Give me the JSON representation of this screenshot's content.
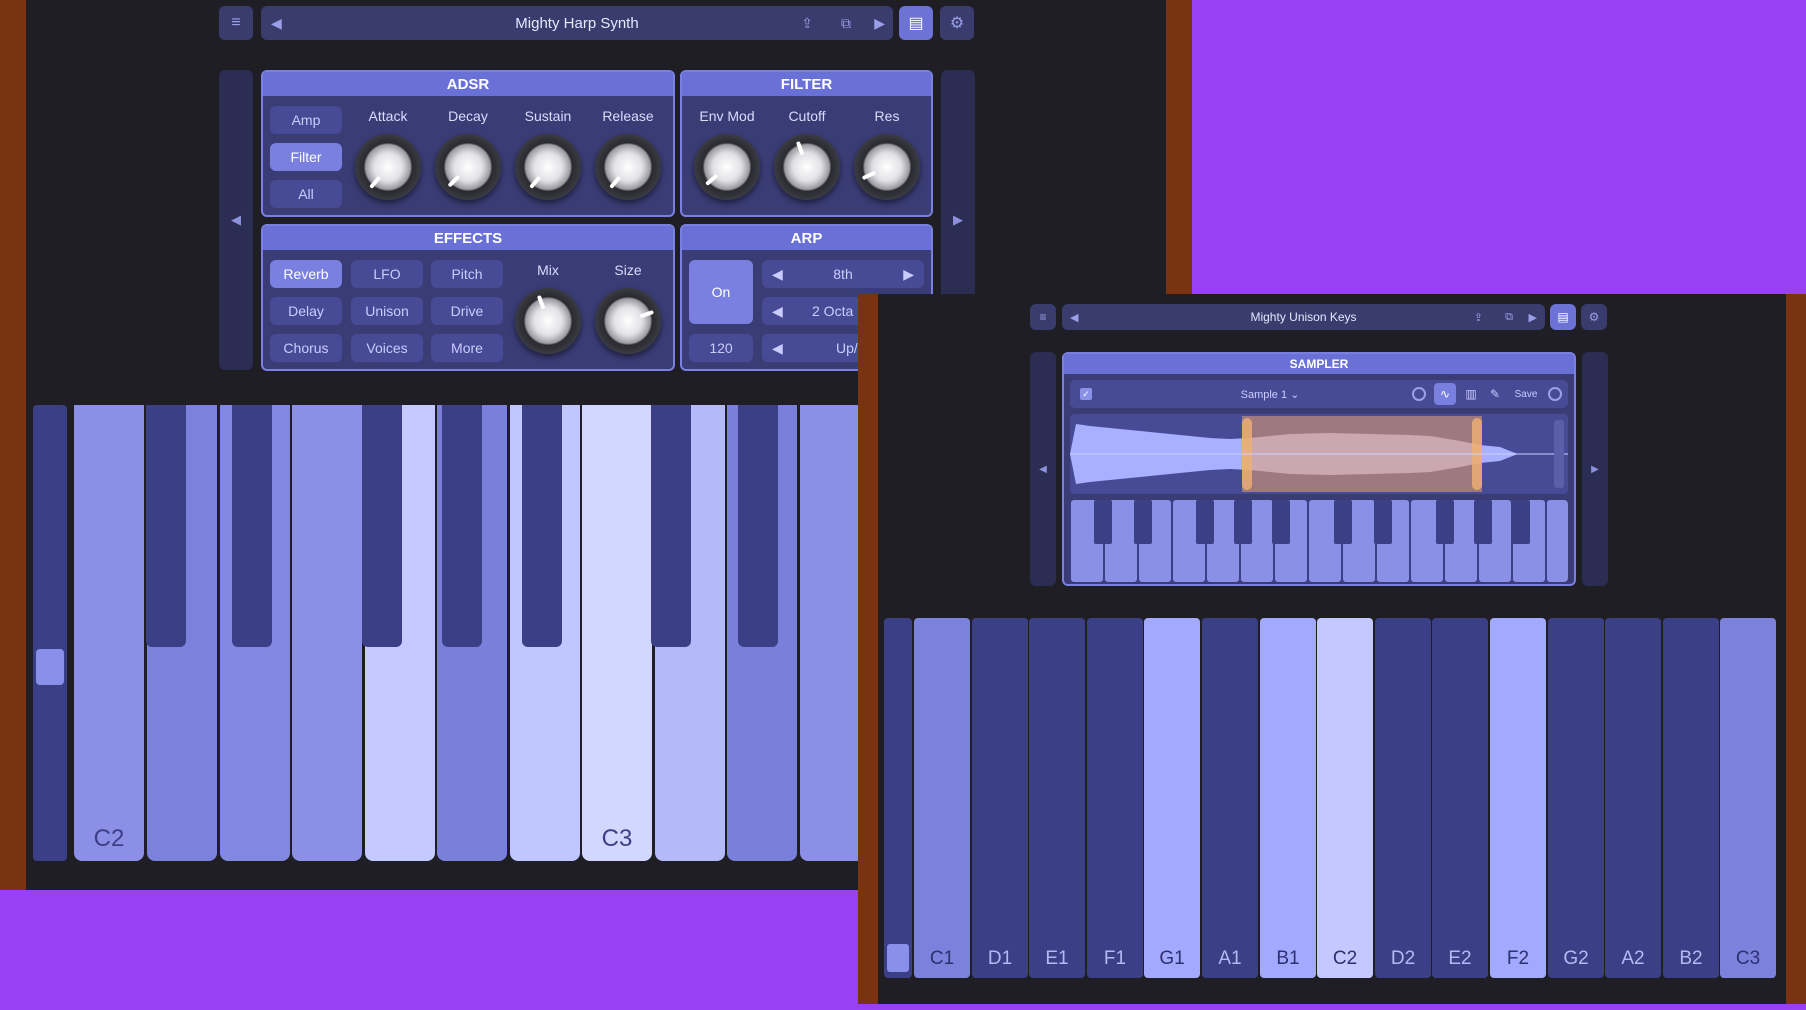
{
  "main_window": {
    "title": "Mighty Harp Synth",
    "adsr": {
      "header": "ADSR",
      "modes": [
        "Amp",
        "Filter",
        "All"
      ],
      "selected_mode": "Filter",
      "knobs": [
        "Attack",
        "Decay",
        "Sustain",
        "Release"
      ]
    },
    "filter": {
      "header": "FILTER",
      "knobs": [
        "Env Mod",
        "Cutoff",
        "Res"
      ]
    },
    "effects": {
      "header": "EFFECTS",
      "buttons": [
        "Reverb",
        "LFO",
        "Pitch",
        "Delay",
        "Unison",
        "Drive",
        "Chorus",
        "Voices",
        "More"
      ],
      "selected": "Reverb",
      "knobs": [
        "Mix",
        "Size"
      ]
    },
    "arp": {
      "header": "ARP",
      "on_label": "On",
      "tempo": "120",
      "rate": "8th",
      "octaves": "2 Octa",
      "direction": "Up/Dow"
    },
    "keyboard": {
      "label_c2": "C2",
      "label_c3": "C3"
    }
  },
  "second_window": {
    "title": "Mighty Unison Keys",
    "sampler": {
      "header": "SAMPLER",
      "sample_name": "Sample 1 ⌄",
      "save_label": "Save"
    },
    "keyboard": {
      "notes": [
        "C1",
        "D1",
        "E1",
        "F1",
        "G1",
        "A1",
        "B1",
        "C2",
        "D2",
        "E2",
        "F2",
        "G2",
        "A2",
        "B2",
        "C3"
      ],
      "lit_notes": [
        "G1",
        "B1",
        "C2",
        "F2"
      ]
    }
  },
  "colors": {
    "background": "#9a40f3",
    "panel_header": "#6a71d6",
    "accent": "#7a80e0",
    "key_light": "#c3c9ff",
    "key_dark": "#3b3f86"
  }
}
